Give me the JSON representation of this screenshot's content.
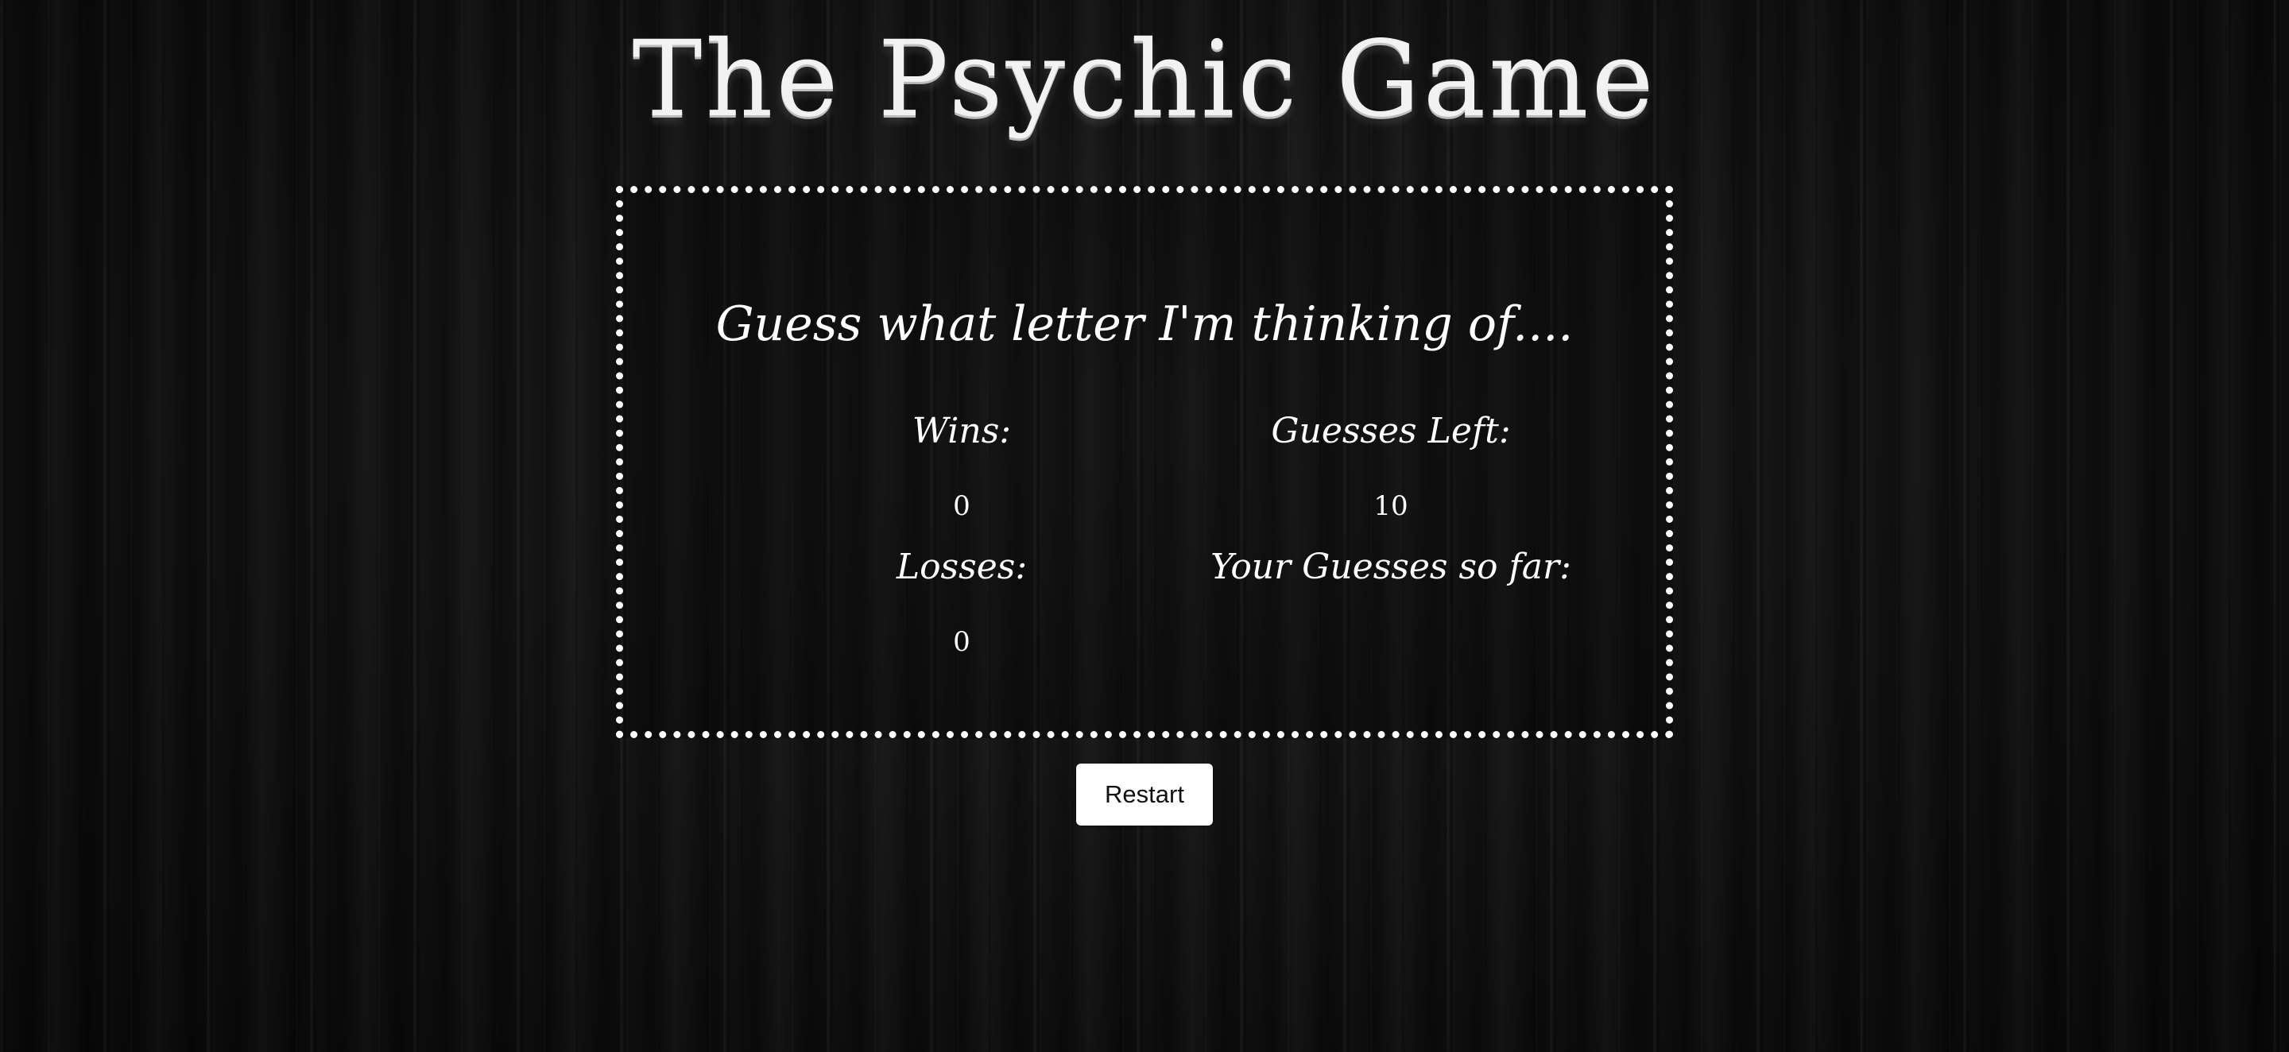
{
  "header": {
    "title": "The Psychic Game"
  },
  "game": {
    "prompt": "Guess what letter I'm thinking of....",
    "wins_label": "Wins:",
    "wins_value": "0",
    "losses_label": "Losses:",
    "losses_value": "0",
    "guesses_left_label": "Guesses Left:",
    "guesses_left_value": "10",
    "guesses_so_far_label": "Your Guesses so far:",
    "guesses_so_far_value": ""
  },
  "controls": {
    "restart_label": "Restart"
  },
  "colors": {
    "background": "#0e0e0e",
    "text": "#ffffff",
    "button_background": "#ffffff",
    "button_text": "#111111"
  }
}
